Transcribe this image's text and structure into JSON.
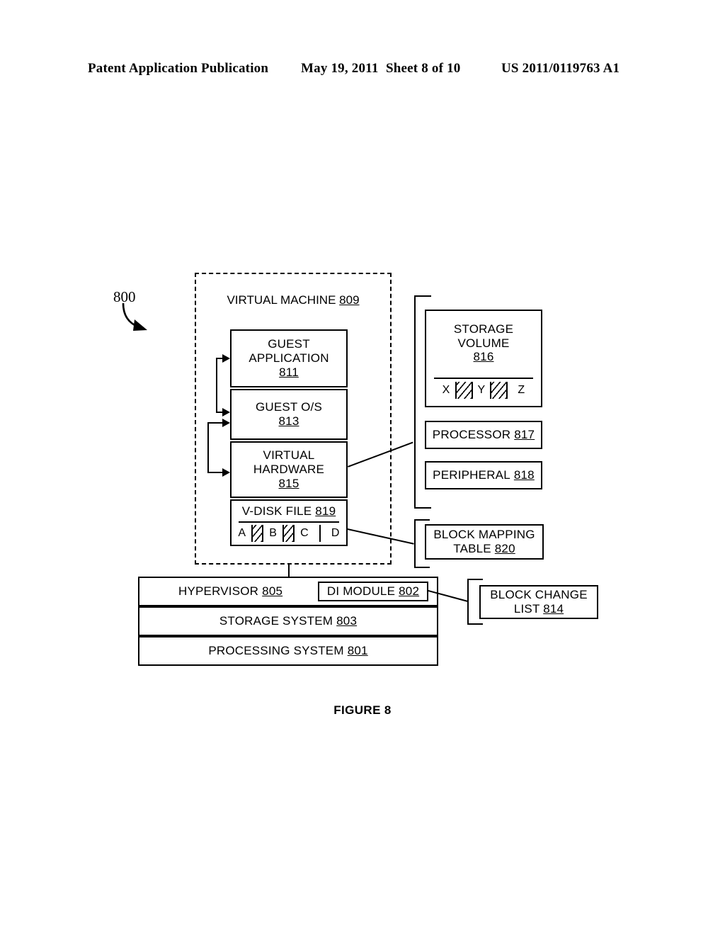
{
  "header": {
    "publication": "Patent Application Publication",
    "date": "May 19, 2011",
    "sheet": "Sheet 8 of 10",
    "patent_number": "US 2011/0119763 A1"
  },
  "figure": {
    "caption": "FIGURE 8",
    "system_label": "800"
  },
  "diagram": {
    "virtual_machine": {
      "title": "VIRTUAL MACHINE",
      "ref": "809"
    },
    "guest_application": {
      "line1": "GUEST",
      "line2": "APPLICATION",
      "ref": "811"
    },
    "guest_os": {
      "line1": "GUEST O/S",
      "ref": "813"
    },
    "virtual_hardware": {
      "line1": "VIRTUAL",
      "line2": "HARDWARE",
      "ref": "815"
    },
    "vdisk_file": {
      "label": "V-DISK FILE",
      "ref": "819",
      "blocks": [
        "A",
        "B",
        "C",
        "D"
      ]
    },
    "storage_volume": {
      "line1": "STORAGE",
      "line2": "VOLUME",
      "ref": "816",
      "blocks": [
        "X",
        "Y",
        "Z"
      ]
    },
    "processor": {
      "label": "PROCESSOR",
      "ref": "817"
    },
    "peripheral": {
      "label": "PERIPHERAL",
      "ref": "818"
    },
    "block_mapping_table": {
      "line1": "BLOCK MAPPING",
      "line2": "TABLE",
      "ref": "820"
    },
    "block_change_list": {
      "line1": "BLOCK CHANGE",
      "line2": "LIST",
      "ref": "814"
    },
    "hypervisor": {
      "label": "HYPERVISOR",
      "ref": "805"
    },
    "di_module": {
      "label": "DI MODULE",
      "ref": "802"
    },
    "storage_system": {
      "label": "STORAGE SYSTEM",
      "ref": "803"
    },
    "processing_system": {
      "label": "PROCESSING SYSTEM",
      "ref": "801"
    }
  }
}
